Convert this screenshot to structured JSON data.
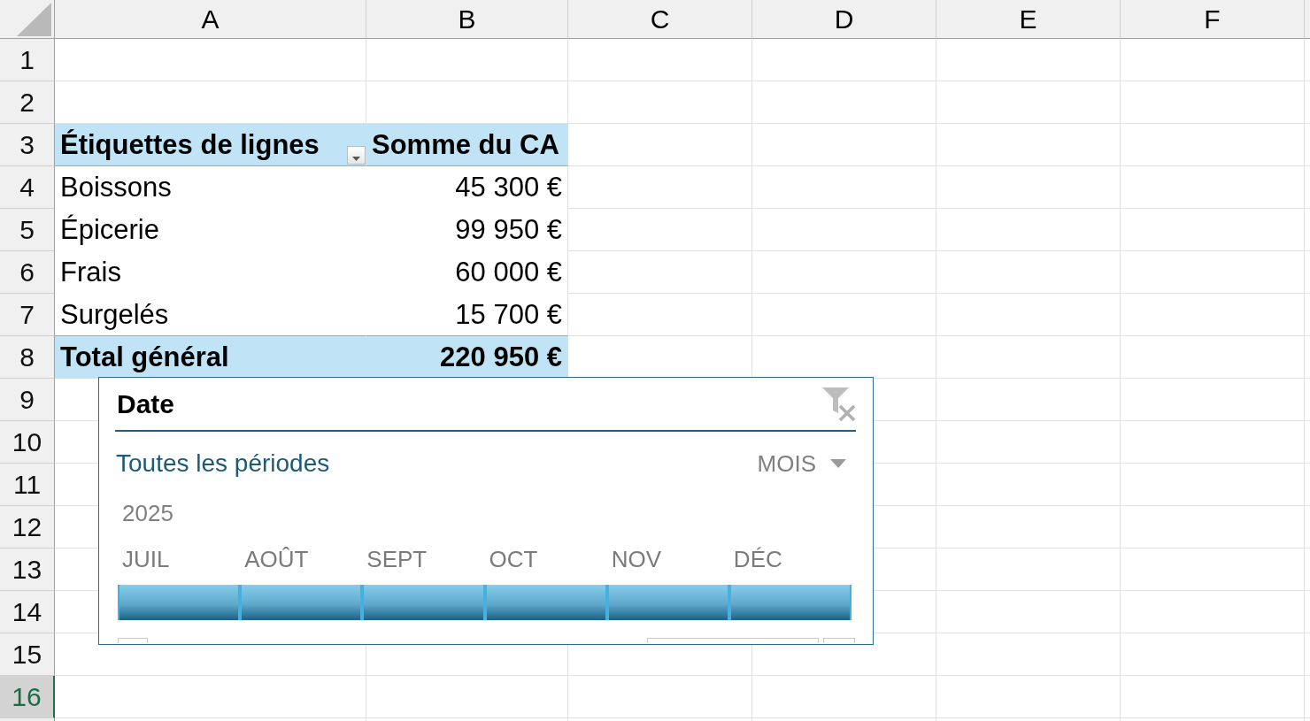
{
  "sheet": {
    "columns": [
      "A",
      "B",
      "C",
      "D",
      "E",
      "F"
    ],
    "rows": [
      {
        "label": "1",
        "selected": false
      },
      {
        "label": "2",
        "selected": false
      },
      {
        "label": "3",
        "selected": false
      },
      {
        "label": "4",
        "selected": false
      },
      {
        "label": "5",
        "selected": false
      },
      {
        "label": "6",
        "selected": false
      },
      {
        "label": "7",
        "selected": false
      },
      {
        "label": "8",
        "selected": false
      },
      {
        "label": "9",
        "selected": false
      },
      {
        "label": "10",
        "selected": false
      },
      {
        "label": "11",
        "selected": false
      },
      {
        "label": "12",
        "selected": false
      },
      {
        "label": "13",
        "selected": false
      },
      {
        "label": "14",
        "selected": false
      },
      {
        "label": "15",
        "selected": false
      },
      {
        "label": "16",
        "selected": true
      }
    ],
    "pivot_table": {
      "header": {
        "row_labels": "Étiquettes de lignes",
        "values": "Somme du CA"
      },
      "rows": [
        {
          "label": "Boissons",
          "value": "45 300 €"
        },
        {
          "label": "Épicerie",
          "value": "99 950 €"
        },
        {
          "label": "Frais",
          "value": "60 000 €"
        },
        {
          "label": "Surgelés",
          "value": "15 700 €"
        }
      ],
      "total": {
        "label": "Total général",
        "value": "220 950 €"
      }
    }
  },
  "timeline": {
    "title": "Date",
    "clear_filter": {
      "disabled": true
    },
    "selection_label": "Toutes les périodes",
    "time_level": "MOIS",
    "year": "2025",
    "months": [
      {
        "label": "JUIL",
        "selected": true
      },
      {
        "label": "AOÛT",
        "selected": true
      },
      {
        "label": "SEPT",
        "selected": true
      },
      {
        "label": "OCT",
        "selected": true
      },
      {
        "label": "NOV",
        "selected": true
      },
      {
        "label": "DÉC",
        "selected": true
      }
    ]
  }
}
